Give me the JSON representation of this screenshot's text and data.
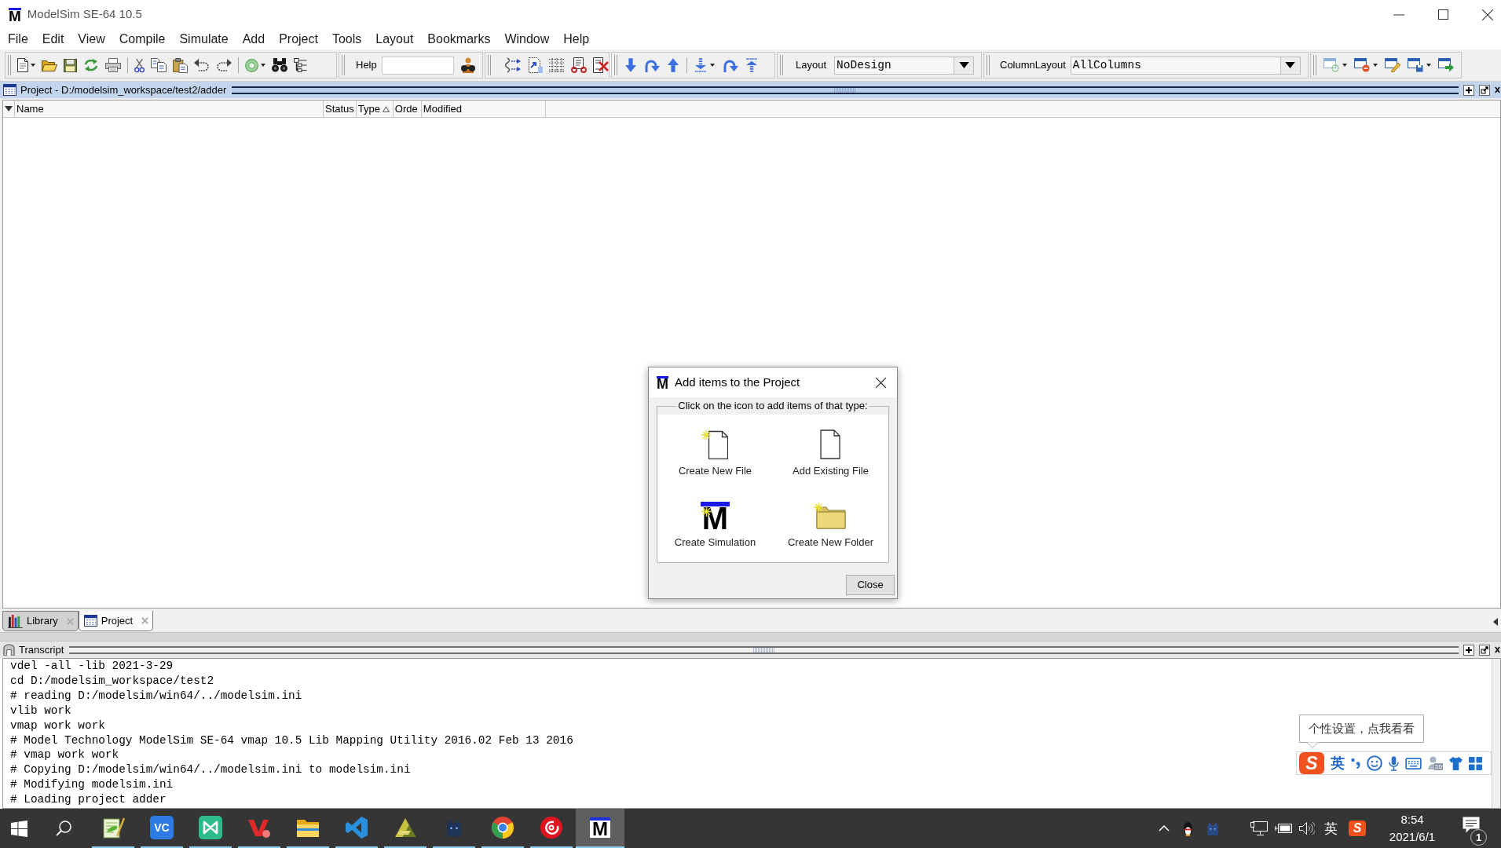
{
  "window": {
    "logo": "M",
    "title": "ModelSim SE-64 10.5"
  },
  "menu": [
    "File",
    "Edit",
    "View",
    "Compile",
    "Simulate",
    "Add",
    "Project",
    "Tools",
    "Layout",
    "Bookmarks",
    "Window",
    "Help"
  ],
  "toolbar": {
    "help_label": "Help",
    "layout": {
      "label": "Layout",
      "value": "NoDesign"
    },
    "column_layout": {
      "label": "ColumnLayout",
      "value": "AllColumns"
    }
  },
  "project_pane": {
    "title": "Project - D:/modelsim_workspace/test2/adder",
    "active": true,
    "columns": [
      {
        "label": "Name",
        "sorted": false
      },
      {
        "label": "Status",
        "sorted": false
      },
      {
        "label": "Type",
        "sorted": true
      },
      {
        "label": "Orde",
        "sorted": false
      },
      {
        "label": "Modified",
        "sorted": false
      }
    ]
  },
  "pane_tabs": [
    {
      "kind": "library",
      "label": "Library",
      "selected": false
    },
    {
      "kind": "project",
      "label": "Project",
      "selected": true
    }
  ],
  "transcript": {
    "title": "Transcript",
    "active": false,
    "lines": [
      "vdel -all -lib 2021-3-29",
      "cd D:/modelsim_workspace/test2",
      "# reading D:/modelsim/win64/../modelsim.ini",
      "vlib work",
      "vmap work work",
      "# Model Technology ModelSim SE-64 vmap 10.5 Lib Mapping Utility 2016.02 Feb 13 2016",
      "# vmap work work",
      "# Copying D:/modelsim/win64/../modelsim.ini to modelsim.ini",
      "# Modifying modelsim.ini",
      "# Loading project adder"
    ]
  },
  "dialog": {
    "logo": "M",
    "title": "Add items to the Project",
    "group_label": "Click on the icon to add items of that type:",
    "items": [
      {
        "kind": "new_file",
        "label": "Create New File"
      },
      {
        "kind": "existing_file",
        "label": "Add Existing File"
      },
      {
        "kind": "simulation",
        "logo": "M",
        "label": "Create Simulation"
      },
      {
        "kind": "new_folder",
        "label": "Create New Folder"
      }
    ],
    "close_button": "Close"
  },
  "ime": {
    "tooltip": "个性设置，点我看看",
    "logo": "S",
    "mode": "英",
    "badge": "10"
  },
  "taskbar": {
    "apps": [
      {
        "kind": "notepad",
        "running": true,
        "selected": false
      },
      {
        "kind": "letters",
        "glyph": "VC",
        "running": true,
        "selected": false
      },
      {
        "kind": "bowtie",
        "running": true,
        "selected": false
      },
      {
        "kind": "chevron",
        "running": true,
        "selected": false
      },
      {
        "kind": "folder",
        "running": true,
        "selected": false
      },
      {
        "kind": "ribbon",
        "running": true,
        "selected": false
      },
      {
        "kind": "triangles",
        "running": true,
        "selected": false
      },
      {
        "kind": "cat",
        "running": true,
        "selected": false
      },
      {
        "kind": "ring",
        "running": true,
        "selected": false
      },
      {
        "kind": "disc",
        "running": true,
        "selected": false
      },
      {
        "kind": "logo",
        "glyph": "M",
        "running": true,
        "selected": true
      }
    ],
    "tray": {
      "input_mode": "英",
      "ime_logo": "S"
    },
    "clock": {
      "time": "8:54",
      "date": "2021/6/1"
    },
    "notifications": "1"
  }
}
